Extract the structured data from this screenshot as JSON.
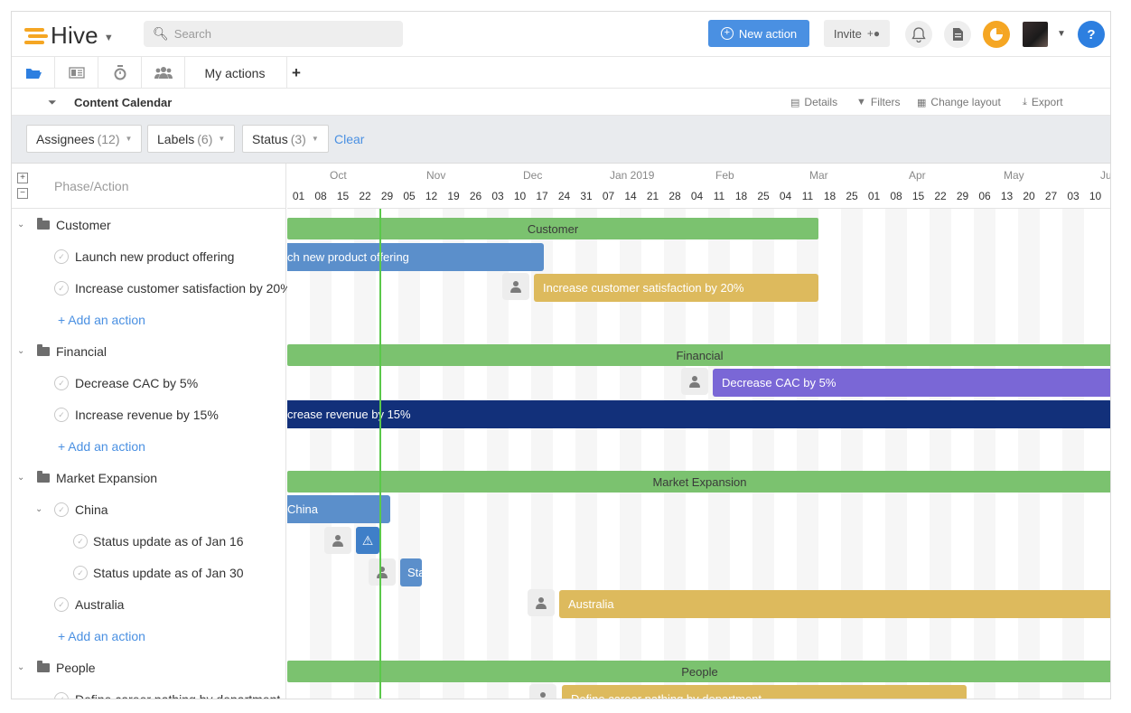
{
  "app": {
    "logo_text": "Hive",
    "search_placeholder": "Search",
    "new_action_label": "New action",
    "invite_label": "Invite"
  },
  "view_tabs": {
    "my_actions_label": "My actions",
    "add_label": "+"
  },
  "project": {
    "title": "Content Calendar",
    "tools": [
      "Details",
      "Filters",
      "Change layout",
      "Export"
    ]
  },
  "filters": {
    "assignees": {
      "label": "Assignees",
      "count": "(12)"
    },
    "labels": {
      "label": "Labels",
      "count": "(6)"
    },
    "status": {
      "label": "Status",
      "count": "(3)"
    },
    "clear_label": "Clear"
  },
  "left_panel": {
    "header": "Phase/Action",
    "rows": [
      {
        "text": "Customer"
      },
      {
        "text": "Launch new product offering"
      },
      {
        "text": "Increase customer satisfaction by 20%"
      },
      {
        "text": "+ Add an action"
      },
      {
        "text": "Financial"
      },
      {
        "text": "Decrease CAC by 5%"
      },
      {
        "text": "Increase revenue by 15%"
      },
      {
        "text": "+ Add an action"
      },
      {
        "text": "Market Expansion"
      },
      {
        "text": "China"
      },
      {
        "text": "Status update as of Jan 16"
      },
      {
        "text": "Status update as of Jan 30"
      },
      {
        "text": "Australia"
      },
      {
        "text": "+ Add an action"
      },
      {
        "text": "People"
      },
      {
        "text": "Define career pathing by department"
      }
    ]
  },
  "timeline": {
    "months": [
      "Oct",
      "Nov",
      "Dec",
      "Jan 2019",
      "Feb",
      "Mar",
      "Apr",
      "May",
      "Ju"
    ],
    "days": [
      "01",
      "08",
      "15",
      "22",
      "29",
      "05",
      "12",
      "19",
      "26",
      "03",
      "10",
      "17",
      "24",
      "31",
      "07",
      "14",
      "21",
      "28",
      "04",
      "11",
      "18",
      "25",
      "04",
      "11",
      "18",
      "25",
      "01",
      "08",
      "15",
      "22",
      "29",
      "06",
      "13",
      "20",
      "27",
      "03",
      "10"
    ]
  },
  "gantt_bars": [
    {
      "label": "Customer"
    },
    {
      "label": "ch new product offering"
    },
    {
      "label": "Increase customer satisfaction by 20%"
    },
    {
      "label": "Financial"
    },
    {
      "label": "Decrease CAC by 5%"
    },
    {
      "label": "crease revenue by 15%"
    },
    {
      "label": "Market Expansion"
    },
    {
      "label": "China"
    },
    {
      "label": "Sta"
    },
    {
      "label": "Australia"
    },
    {
      "label": "People"
    },
    {
      "label": "Define career pathing by department"
    }
  ],
  "colors": {
    "accent": "#4a90e2",
    "phase_bar": "#7bc26f",
    "blue_bar": "#5b8fcb",
    "yellow_bar": "#ddba5d",
    "purple_bar": "#7a67d6",
    "navy_bar": "#12307a",
    "today_line": "#5ac84a"
  }
}
